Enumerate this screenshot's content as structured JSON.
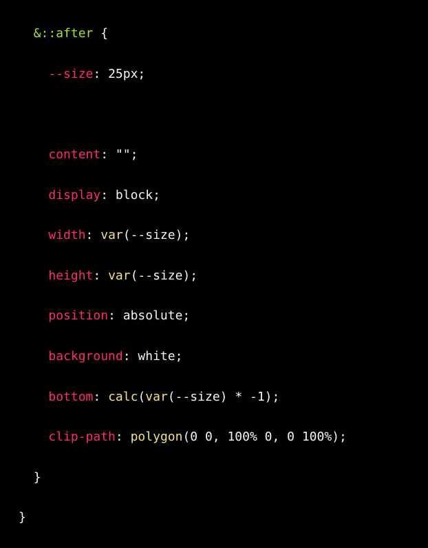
{
  "code": {
    "selector": "&::after",
    "open_brace": " {",
    "var_decl": {
      "prop": "--size",
      "value": ": 25px;"
    },
    "declarations": [
      {
        "prop": "content",
        "func": "",
        "value": ": \"\";"
      },
      {
        "prop": "display",
        "func": "",
        "value": ": block;"
      },
      {
        "prop": "width",
        "sep": ": ",
        "func": "var",
        "value": "(--size);"
      },
      {
        "prop": "height",
        "sep": ": ",
        "func": "var",
        "value": "(--size);"
      },
      {
        "prop": "position",
        "func": "",
        "value": ": absolute;"
      },
      {
        "prop": "background",
        "func": "",
        "value": ": white;"
      },
      {
        "prop": "bottom",
        "sep": ": ",
        "func": "calc",
        "func2": "var",
        "value_mid": "(",
        "value": "(--size) * -1);"
      },
      {
        "prop": "clip-path",
        "sep": ": ",
        "func": "polygon",
        "value": "(0 0, 100% 0, 0 100%);"
      }
    ],
    "inner_close": "}",
    "outer_close": "}"
  },
  "colors": {
    "background": "#000000",
    "selector": "#a6e22e",
    "property": "#ff2b6e",
    "function": "#f2e27a",
    "text": "#f5f5f5"
  }
}
